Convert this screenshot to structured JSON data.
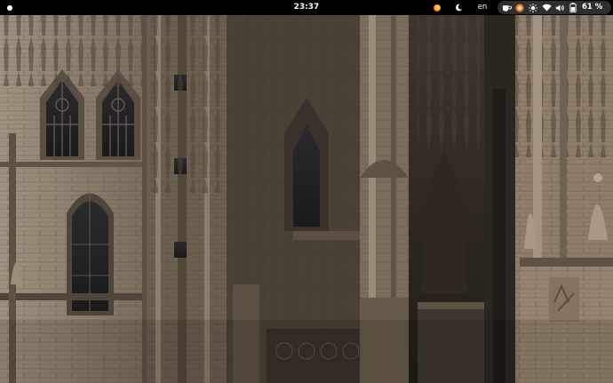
{
  "topbar": {
    "clock": "23:37",
    "keyboard_layout": "en",
    "battery_percent": "61 %"
  },
  "icons": {
    "activities": "activities-dot-icon",
    "firefox": "firefox-icon",
    "night_light": "crescent-icon",
    "coffee": "caffeine-icon",
    "shell": "shell-extension-icon",
    "brightness": "brightness-icon",
    "network": "wifi-icon",
    "volume": "volume-icon",
    "battery": "battery-icon"
  },
  "colors": {
    "topbar_bg": "#000000",
    "pill_bg": "#2e2e2e",
    "text": "#ffffff"
  },
  "wallpaper": {
    "subject": "gothic-cathedral-facade"
  }
}
